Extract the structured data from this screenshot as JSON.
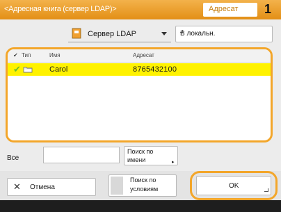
{
  "header": {
    "title": "<Адресная книга (сервер LDAP)>",
    "tab_label": "Адресат",
    "count": "1"
  },
  "toolbar": {
    "server_label": "Сервер LDAP",
    "local_button": "В локальн."
  },
  "list": {
    "columns": [
      "Тип",
      "Имя",
      "Адресат"
    ],
    "rows": [
      {
        "name": "Carol",
        "address": "8765432100",
        "checked": true,
        "type_icon": "network-folder-icon"
      }
    ]
  },
  "filter": {
    "label": "Все",
    "input_value": "",
    "search_by_name_line1": "Поиск по",
    "search_by_name_line2": "имени"
  },
  "actions": {
    "cancel": "Отмена",
    "search_by_cond_line1": "Поиск по",
    "search_by_cond_line2": "условиям",
    "ok": "OK"
  },
  "colors": {
    "accent": "#f3a62a",
    "selection": "#fff200",
    "check": "#6cbe2c"
  }
}
